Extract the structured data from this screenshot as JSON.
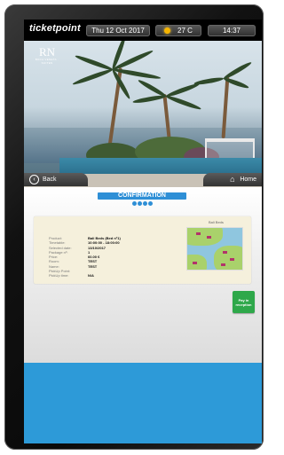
{
  "topbar": {
    "logo": "ticketpoint",
    "date": "Thu 12 Oct 2017",
    "temperature": "27 C",
    "time": "14:37",
    "weather_icon": "sun-icon"
  },
  "hero": {
    "brand_monogram": "RN",
    "brand_name": "BOCA VENETA · SUITES"
  },
  "nav": {
    "back_label": "Back",
    "home_label": "Home"
  },
  "confirmation": {
    "title": "CONFIRMATION",
    "steps": 4,
    "details": [
      {
        "label": "Product:",
        "value": "Bali Beds (Bed nº1)"
      },
      {
        "label": "Timetable:",
        "value": "10:00:00 - 18:00:00"
      },
      {
        "label": "Selected date:",
        "value": "13/10/2017"
      },
      {
        "label": "Package nº:",
        "value": "1"
      },
      {
        "label": "Price:",
        "value": "60.00 €"
      },
      {
        "label": "Room:",
        "value": "TEST"
      },
      {
        "label": "Name:",
        "value": "TEST"
      },
      {
        "label": "PickUp Point:",
        "value": ""
      },
      {
        "label": "PickUp time:",
        "value": "N/A"
      }
    ],
    "map_title": "Bali Beds"
  },
  "actions": {
    "pay_label": "Pay in reception"
  },
  "colors": {
    "accent": "#2e8fd6",
    "pay_button": "#2ea84a",
    "card_bg": "#f5f0dc"
  }
}
